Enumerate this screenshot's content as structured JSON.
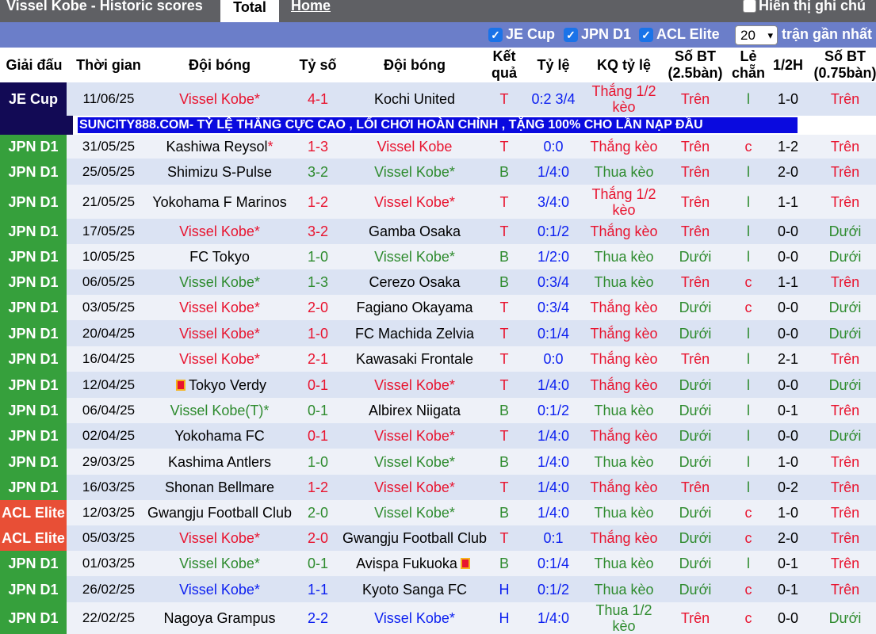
{
  "page": {
    "title": "Vissel Kobe - Historic scores",
    "tabs": [
      "Total",
      "Home"
    ],
    "show_notes_label": "Hiển thị ghi chú"
  },
  "filters": {
    "items": [
      "JE Cup",
      "JPN D1",
      "ACL Elite"
    ],
    "recent_count": "20",
    "recent_label": "trận gần nhất"
  },
  "columns": {
    "competition": "Giải đấu",
    "time": "Thời gian",
    "team_home": "Đội bóng",
    "score": "Tỷ số",
    "team_away": "Đội bóng",
    "result": "Kết quả",
    "odds": "Tỷ lệ",
    "odds_result": "KQ tỷ lệ",
    "ou_25": "Số BT (2.5bàn)",
    "odd_even": "Lẻ chẵn",
    "half": "1/2H",
    "ou_075": "Số BT (0.75bàn)"
  },
  "banner": "SUNCITY888.COM- TỶ LỆ THẮNG CỰC CAO , LỐI CHƠI HOÀN CHỈNH , TẶNG 100% CHO LẦN NẠP ĐẦU",
  "colors": {
    "je_cup": "#120a55",
    "jpn_d1": "#36a03c",
    "acl_elite": "#e84f36",
    "win_red": "#e8142f",
    "loss_green": "#2e8b2e",
    "draw_blue": "#0b1ff0"
  },
  "rows": [
    {
      "comp": "JE Cup",
      "date": "11/06/25",
      "home": "Vissel Kobe*",
      "score": "4-1",
      "away": "Kochi United",
      "res": "T",
      "odds": "0:2 3/4",
      "kq": "Thắng 1/2 kèo",
      "ou": "Trên",
      "le": "l",
      "half": "1-0",
      "ou2": "Trên"
    },
    {
      "comp": "JPN D1",
      "date": "31/05/25",
      "home": "Kashiwa Reysol",
      "home_star": "*",
      "score": "1-3",
      "away": "Vissel Kobe",
      "res": "T",
      "odds": "0:0",
      "kq": "Thắng kèo",
      "ou": "Trên",
      "le": "c",
      "half": "1-2",
      "ou2": "Trên"
    },
    {
      "comp": "JPN D1",
      "date": "25/05/25",
      "home": "Shimizu S-Pulse",
      "score": "3-2",
      "away": "Vissel Kobe*",
      "res": "B",
      "odds": "1/4:0",
      "kq": "Thua kèo",
      "ou": "Trên",
      "le": "l",
      "half": "2-0",
      "ou2": "Trên"
    },
    {
      "comp": "JPN D1",
      "date": "21/05/25",
      "home": "Yokohama F Marinos",
      "score": "1-2",
      "away": "Vissel Kobe*",
      "res": "T",
      "odds": "3/4:0",
      "kq": "Thắng 1/2 kèo",
      "ou": "Trên",
      "le": "l",
      "half": "1-1",
      "ou2": "Trên"
    },
    {
      "comp": "JPN D1",
      "date": "17/05/25",
      "home": "Vissel Kobe*",
      "score": "3-2",
      "away": "Gamba Osaka",
      "res": "T",
      "odds": "0:1/2",
      "kq": "Thắng kèo",
      "ou": "Trên",
      "le": "l",
      "half": "0-0",
      "ou2": "Dưới"
    },
    {
      "comp": "JPN D1",
      "date": "10/05/25",
      "home": "FC Tokyo",
      "score": "1-0",
      "away": "Vissel Kobe*",
      "res": "B",
      "odds": "1/2:0",
      "kq": "Thua kèo",
      "ou": "Dưới",
      "le": "l",
      "half": "0-0",
      "ou2": "Dưới"
    },
    {
      "comp": "JPN D1",
      "date": "06/05/25",
      "home": "Vissel Kobe*",
      "score": "1-3",
      "away": "Cerezo Osaka",
      "res": "B",
      "odds": "0:3/4",
      "kq": "Thua kèo",
      "ou": "Trên",
      "le": "c",
      "half": "1-1",
      "ou2": "Trên"
    },
    {
      "comp": "JPN D1",
      "date": "03/05/25",
      "home": "Vissel Kobe*",
      "score": "2-0",
      "away": "Fagiano Okayama",
      "res": "T",
      "odds": "0:3/4",
      "kq": "Thắng kèo",
      "ou": "Dưới",
      "le": "c",
      "half": "0-0",
      "ou2": "Dưới"
    },
    {
      "comp": "JPN D1",
      "date": "20/04/25",
      "home": "Vissel Kobe*",
      "score": "1-0",
      "away": "FC Machida Zelvia",
      "res": "T",
      "odds": "0:1/4",
      "kq": "Thắng kèo",
      "ou": "Dưới",
      "le": "l",
      "half": "0-0",
      "ou2": "Dưới"
    },
    {
      "comp": "JPN D1",
      "date": "16/04/25",
      "home": "Vissel Kobe*",
      "score": "2-1",
      "away": "Kawasaki Frontale",
      "res": "T",
      "odds": "0:0",
      "kq": "Thắng kèo",
      "ou": "Trên",
      "le": "l",
      "half": "2-1",
      "ou2": "Trên"
    },
    {
      "comp": "JPN D1",
      "date": "12/04/25",
      "home": "Tokyo Verdy",
      "home_flag": true,
      "score": "0-1",
      "away": "Vissel Kobe*",
      "res": "T",
      "odds": "1/4:0",
      "kq": "Thắng kèo",
      "ou": "Dưới",
      "le": "l",
      "half": "0-0",
      "ou2": "Dưới"
    },
    {
      "comp": "JPN D1",
      "date": "06/04/25",
      "home": "Vissel Kobe(T)*",
      "score": "0-1",
      "away": "Albirex Niigata",
      "res": "B",
      "odds": "0:1/2",
      "kq": "Thua kèo",
      "ou": "Dưới",
      "le": "l",
      "half": "0-1",
      "ou2": "Trên"
    },
    {
      "comp": "JPN D1",
      "date": "02/04/25",
      "home": "Yokohama FC",
      "score": "0-1",
      "away": "Vissel Kobe*",
      "res": "T",
      "odds": "1/4:0",
      "kq": "Thắng kèo",
      "ou": "Dưới",
      "le": "l",
      "half": "0-0",
      "ou2": "Dưới"
    },
    {
      "comp": "JPN D1",
      "date": "29/03/25",
      "home": "Kashima Antlers",
      "score": "1-0",
      "away": "Vissel Kobe*",
      "res": "B",
      "odds": "1/4:0",
      "kq": "Thua kèo",
      "ou": "Dưới",
      "le": "l",
      "half": "1-0",
      "ou2": "Trên"
    },
    {
      "comp": "JPN D1",
      "date": "16/03/25",
      "home": "Shonan Bellmare",
      "score": "1-2",
      "away": "Vissel Kobe*",
      "res": "T",
      "odds": "1/4:0",
      "kq": "Thắng kèo",
      "ou": "Trên",
      "le": "l",
      "half": "0-2",
      "ou2": "Trên"
    },
    {
      "comp": "ACL Elite",
      "date": "12/03/25",
      "home": "Gwangju Football Club",
      "score": "2-0",
      "away": "Vissel Kobe*",
      "res": "B",
      "odds": "1/4:0",
      "kq": "Thua kèo",
      "ou": "Dưới",
      "le": "c",
      "half": "1-0",
      "ou2": "Trên"
    },
    {
      "comp": "ACL Elite",
      "date": "05/03/25",
      "home": "Vissel Kobe*",
      "score": "2-0",
      "away": "Gwangju Football Club",
      "res": "T",
      "odds": "0:1",
      "kq": "Thắng kèo",
      "ou": "Dưới",
      "le": "c",
      "half": "2-0",
      "ou2": "Trên"
    },
    {
      "comp": "JPN D1",
      "date": "01/03/25",
      "home": "Vissel Kobe*",
      "score": "0-1",
      "away": "Avispa Fukuoka",
      "away_flag": true,
      "res": "B",
      "odds": "0:1/4",
      "kq": "Thua kèo",
      "ou": "Dưới",
      "le": "l",
      "half": "0-1",
      "ou2": "Trên"
    },
    {
      "comp": "JPN D1",
      "date": "26/02/25",
      "home": "Vissel Kobe*",
      "score": "1-1",
      "away": "Kyoto Sanga FC",
      "res": "H",
      "odds": "0:1/2",
      "kq": "Thua kèo",
      "ou": "Dưới",
      "le": "c",
      "half": "0-1",
      "ou2": "Trên"
    },
    {
      "comp": "JPN D1",
      "date": "22/02/25",
      "home": "Nagoya Grampus",
      "score": "2-2",
      "away": "Vissel Kobe*",
      "res": "H",
      "odds": "1/4:0",
      "kq": "Thua 1/2 kèo",
      "ou": "Trên",
      "le": "c",
      "half": "0-0",
      "ou2": "Dưới"
    }
  ]
}
